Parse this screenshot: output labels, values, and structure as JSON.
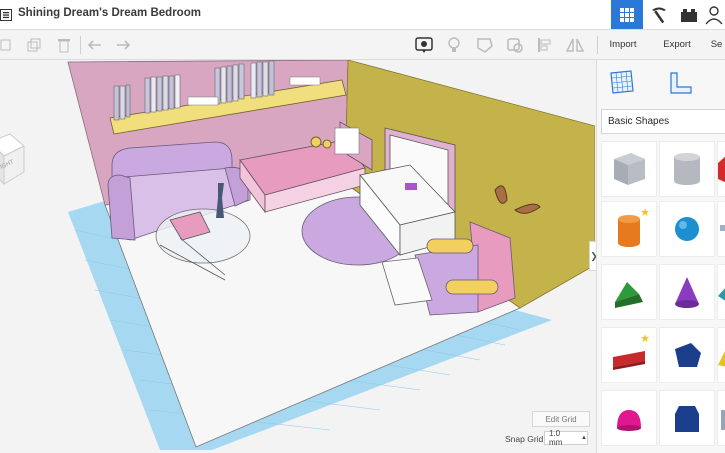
{
  "header": {
    "title": "Shining Dream's Dream Bedroom"
  },
  "toolbar": {
    "import_label": "Import",
    "export_label": "Export",
    "send_label": "Se"
  },
  "viewcube": {
    "face_label": "IGHT"
  },
  "viewport": {
    "edit_grid_label": "Edit Grid",
    "snap_grid_label": "Snap Grid",
    "snap_grid_value": "1.0 mm"
  },
  "panel": {
    "category": "Basic Shapes",
    "shapes": [
      "Box",
      "Cylinder",
      "Roof",
      "Tube",
      "Sphere",
      "Scribble",
      "Wedge",
      "Cone",
      "Round Roof",
      "Text",
      "Polygon",
      "Pyramid",
      "Half Sphere",
      "Paraboloid",
      "Torus"
    ]
  },
  "colors": {
    "accent": "#2a78d8",
    "wall_left": "#d9a6c2",
    "wall_right": "#c4b34a",
    "furniture": "#c9a9df",
    "grid": "#9fd3f0"
  }
}
